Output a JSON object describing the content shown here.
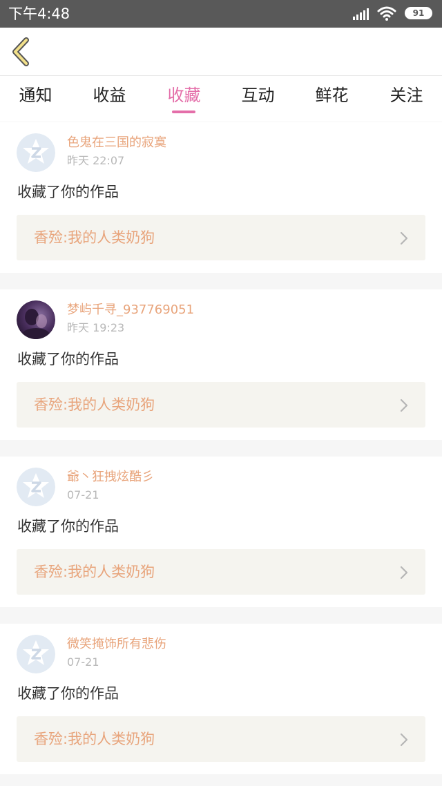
{
  "status_bar": {
    "time": "下午4:48",
    "battery": "91"
  },
  "tabs": [
    {
      "label": "通知",
      "active": false
    },
    {
      "label": "收益",
      "active": false
    },
    {
      "label": "收藏",
      "active": true
    },
    {
      "label": "互动",
      "active": false
    },
    {
      "label": "鲜花",
      "active": false
    },
    {
      "label": "关注",
      "active": false
    }
  ],
  "colors": {
    "accent": "#e46ea9",
    "username": "#e8a47b",
    "status_bar": "#595959",
    "work_box": "#f5f4ef"
  },
  "notifications": [
    {
      "username": "色鬼在三国的寂寞",
      "time": "昨天 22:07",
      "action": "收藏了你的作品",
      "work_title": "香殓:我的人类奶狗",
      "avatar": "default-avatar-icon"
    },
    {
      "username": "梦屿千寻_937769051",
      "time": "昨天 19:23",
      "action": "收藏了你的作品",
      "work_title": "香殓:我的人类奶狗",
      "avatar": "user-photo-avatar"
    },
    {
      "username": "爺丶狂拽炫酷彡",
      "time": "07-21",
      "action": "收藏了你的作品",
      "work_title": "香殓:我的人类奶狗",
      "avatar": "default-avatar-icon"
    },
    {
      "username": "微笑掩饰所有悲伤",
      "time": "07-21",
      "action": "收藏了你的作品",
      "work_title": "香殓:我的人类奶狗",
      "avatar": "default-avatar-icon"
    }
  ]
}
